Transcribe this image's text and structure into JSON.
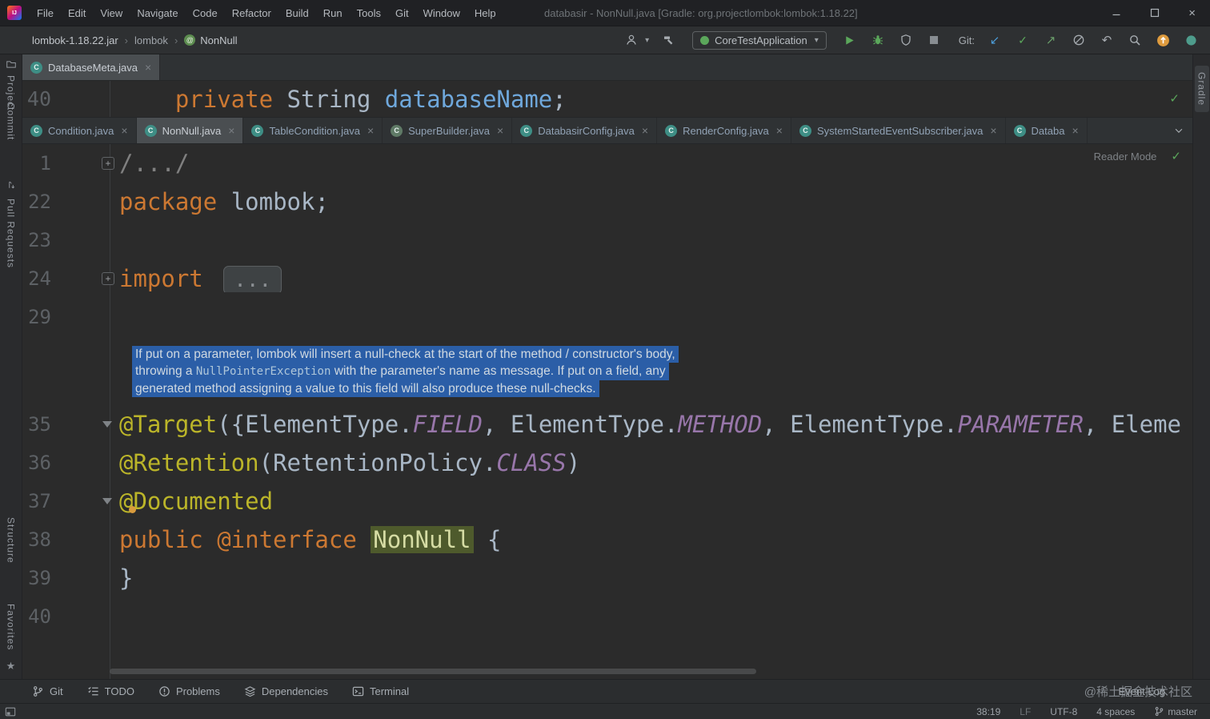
{
  "window": {
    "logo_text": "IJ",
    "menu": [
      "File",
      "Edit",
      "View",
      "Navigate",
      "Code",
      "Refactor",
      "Build",
      "Run",
      "Tools",
      "Git",
      "Window",
      "Help"
    ],
    "title": "databasir - NonNull.java [Gradle: org.projectlombok:lombok:1.18.22]"
  },
  "navbar": {
    "breadcrumbs": [
      "lombok-1.18.22.jar",
      "lombok",
      "NonNull"
    ],
    "run_config": "CoreTestApplication",
    "git_label": "Git:",
    "icons": [
      "user",
      "build-hammer",
      "run",
      "debug",
      "coverage",
      "stop",
      "vcs-update",
      "vcs-commit",
      "vcs-push",
      "vcs-history",
      "vcs-rollback",
      "search",
      "update-notification",
      "plugin"
    ]
  },
  "left_stripe": {
    "top": [
      "Project",
      "Commit",
      "Pull Requests"
    ],
    "bottom": [
      "Structure",
      "Favorites"
    ]
  },
  "right_stripe": {
    "items": [
      "Gradle"
    ]
  },
  "top_editor": {
    "tab": {
      "label": "DatabaseMeta.java",
      "icon": "class-icon"
    },
    "line": {
      "num": "40",
      "tokens": [
        [
          "    ",
          "pl"
        ],
        [
          "private ",
          "kw"
        ],
        [
          "String ",
          "pl"
        ],
        [
          "databaseName",
          "fld"
        ],
        [
          ";",
          "pl"
        ]
      ]
    }
  },
  "tabs": [
    {
      "label": "Condition.java",
      "icon": "class-icon"
    },
    {
      "label": "NonNull.java",
      "icon": "class-icon",
      "selected": true
    },
    {
      "label": "TableCondition.java",
      "icon": "class-icon"
    },
    {
      "label": "SuperBuilder.java",
      "icon": "class-icon",
      "icon_color": "#5F7A66"
    },
    {
      "label": "DatabasirConfig.java",
      "icon": "class-icon"
    },
    {
      "label": "RenderConfig.java",
      "icon": "class-icon"
    },
    {
      "label": "SystemStartedEventSubscriber.java",
      "icon": "class-icon"
    },
    {
      "label": "Databa",
      "icon": "class-icon"
    }
  ],
  "editor": {
    "reader_mode_label": "Reader Mode",
    "lines": [
      {
        "num": "1",
        "fold": "plus",
        "tokens": [
          [
            "/.../",
            "fold"
          ]
        ]
      },
      {
        "num": "22",
        "tokens": [
          [
            "package ",
            "kw"
          ],
          [
            "lombok;",
            "pl"
          ]
        ]
      },
      {
        "num": "23",
        "tokens": []
      },
      {
        "num": "24",
        "fold": "plus",
        "tokens": [
          [
            "import ",
            "kw"
          ],
          [
            "...",
            "foldbox"
          ]
        ]
      },
      {
        "num": "29",
        "tokens": []
      },
      {
        "doc": [
          [
            [
              "If put on a parameter, lombok will insert a null-check at the start of the method / constructor's body,",
              "doc"
            ]
          ],
          [
            [
              "throwing a ",
              "doc"
            ],
            [
              "NullPointerException",
              "doccode"
            ],
            [
              " with the parameter's name as message. If put on a field, any",
              "doc"
            ]
          ],
          [
            [
              "generated method assigning a value to this field will also produce these null-checks.",
              "doc"
            ]
          ]
        ]
      },
      {
        "num": "35",
        "fold": "arrow",
        "tokens": [
          [
            "@Target",
            "ann"
          ],
          [
            "({",
            "pl"
          ],
          [
            "ElementType",
            "pl"
          ],
          [
            ".",
            "pl"
          ],
          [
            "FIELD",
            "const"
          ],
          [
            ", ",
            "pl"
          ],
          [
            "ElementType",
            "pl"
          ],
          [
            ".",
            "pl"
          ],
          [
            "METHOD",
            "const"
          ],
          [
            ", ",
            "pl"
          ],
          [
            "ElementType",
            "pl"
          ],
          [
            ".",
            "pl"
          ],
          [
            "PARAMETER",
            "const"
          ],
          [
            ", ",
            "pl"
          ],
          [
            "Eleme",
            "pl"
          ]
        ]
      },
      {
        "num": "36",
        "tokens": [
          [
            "@Retention",
            "ann"
          ],
          [
            "(RetentionPolicy.",
            "pl"
          ],
          [
            "CLASS",
            "const"
          ],
          [
            ")",
            "pl"
          ]
        ]
      },
      {
        "num": "37",
        "fold": "arrow",
        "tokens": [
          [
            "@Documented",
            "ann"
          ]
        ]
      },
      {
        "num": "38",
        "tokens": [
          [
            "public ",
            "kw"
          ],
          [
            "@interface ",
            "kw"
          ],
          [
            "NonNull",
            "hl"
          ],
          [
            " {",
            "pl"
          ]
        ]
      },
      {
        "num": "39",
        "tokens": [
          [
            "}",
            "pl"
          ]
        ]
      },
      {
        "num": "40",
        "tokens": []
      }
    ]
  },
  "bottom_bar": {
    "items": [
      {
        "label": "Git",
        "icon": "git-branch"
      },
      {
        "label": "TODO",
        "icon": "todo"
      },
      {
        "label": "Problems",
        "icon": "problems"
      },
      {
        "label": "Dependencies",
        "icon": "dependencies"
      },
      {
        "label": "Terminal",
        "icon": "terminal"
      }
    ],
    "event_log": "Event Log"
  },
  "status_bar": {
    "caret": "38:19",
    "line_ending": "LF",
    "encoding": "UTF-8",
    "indent": "4 spaces",
    "branch": "master"
  },
  "watermark": "@稀土掘金技术社区"
}
